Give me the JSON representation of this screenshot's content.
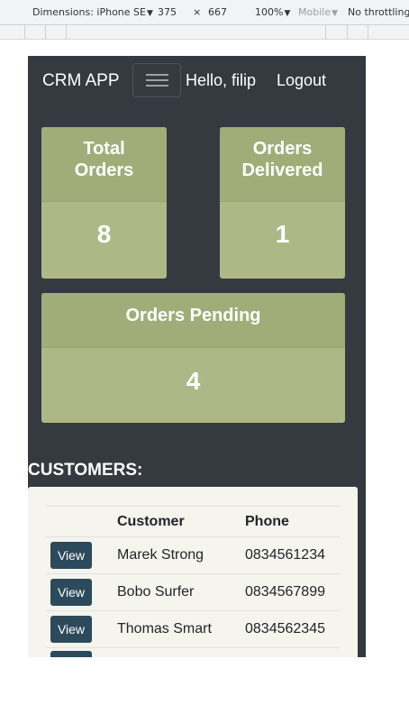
{
  "devtools": {
    "dimensions_label": "Dimensions: iPhone SE",
    "width": "375",
    "times": "×",
    "height": "667",
    "zoom": "100%",
    "mode": "Mobile",
    "throttling": "No throttling"
  },
  "navbar": {
    "brand": "CRM APP",
    "greeting": "Hello, filip",
    "logout": "Logout"
  },
  "stats": {
    "total_orders": {
      "title": "Total Orders",
      "value": "8"
    },
    "orders_delivered": {
      "title": "Orders Delivered",
      "value": "1"
    },
    "orders_pending": {
      "title": "Orders Pending",
      "value": "4"
    }
  },
  "customers": {
    "title": "CUSTOMERS:",
    "columns": [
      "",
      "Customer",
      "Phone"
    ],
    "rows": [
      {
        "action": "View",
        "name": "Marek Strong",
        "phone": "0834561234"
      },
      {
        "action": "View",
        "name": "Bobo Surfer",
        "phone": "0834567899"
      },
      {
        "action": "View",
        "name": "Thomas Smart",
        "phone": "0834562345"
      }
    ]
  },
  "colors": {
    "navbar_bg": "#343a40",
    "card_bg": "#adb886",
    "card_header_bg": "#a1ad79",
    "button_bg": "#2c4a5c",
    "panel_bg": "#f5f5ed"
  }
}
